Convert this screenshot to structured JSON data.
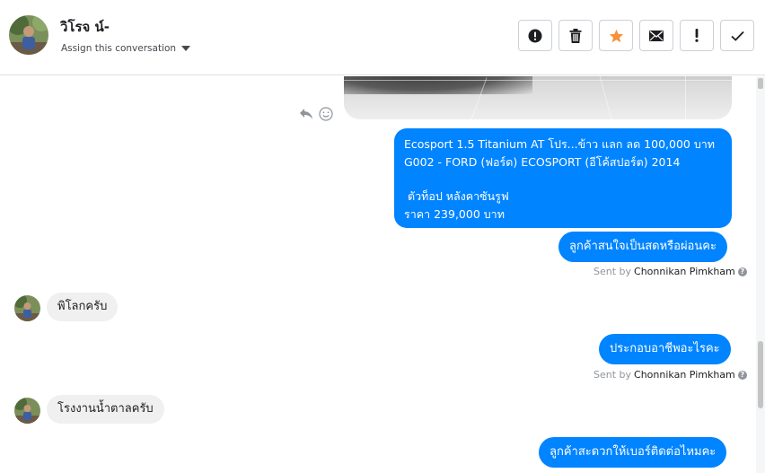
{
  "header": {
    "user_name": "วิโรจ น์-",
    "assign_label": "Assign this conversation"
  },
  "toolbar": [
    {
      "name": "report-button",
      "icon": "alert-circle-icon"
    },
    {
      "name": "delete-button",
      "icon": "trash-icon"
    },
    {
      "name": "star-button",
      "icon": "star-icon",
      "color": "#f7923b"
    },
    {
      "name": "mark-unread-button",
      "icon": "envelope-icon"
    },
    {
      "name": "spam-button",
      "icon": "exclamation-icon"
    },
    {
      "name": "done-button",
      "icon": "checkmark-icon"
    }
  ],
  "messages": {
    "listing_lines": [
      "Ecosport 1.5 Titanium AT โปร...ข้าว แลก ลด 100,000 บาท",
      "G002 - FORD (ฟอร์ด) ECOSPORT (อีโค้สปอร์ต) 2014",
      "",
      " ตัวท็อป หลังคาซันรูฟ",
      "ราคา 239,000 บาท"
    ],
    "out_1": "ลูกค้าสนใจเป็นสดหรือผ่อนคะ",
    "sent_by_prefix": "Sent by",
    "sent_by_name": "Chonnikan Pimkham",
    "in_1": "พิโลกครับ",
    "out_2": "ประกอบอาชีพอะไรคะ",
    "in_2": "โรงงานน้ำตาลครับ",
    "out_3": "ลูกค้าสะดวกให้เบอร์ติดต่อไหมคะ"
  },
  "colors": {
    "outgoing_bubble": "#0084ff",
    "incoming_bubble": "#f1f0f0",
    "accent_star": "#f7923b"
  }
}
